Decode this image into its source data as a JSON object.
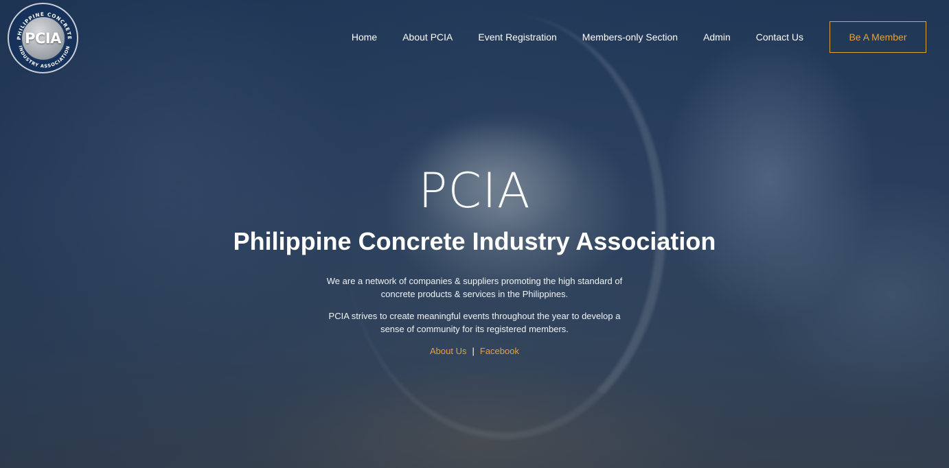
{
  "logo": {
    "abbr": "PCIA",
    "ring_top": "PHILIPPINE CONCRETE",
    "ring_bottom": "INDUSTRY ASSOCIATION"
  },
  "nav": {
    "items": [
      {
        "label": "Home"
      },
      {
        "label": "About PCIA"
      },
      {
        "label": "Event Registration"
      },
      {
        "label": "Members-only Section"
      },
      {
        "label": "Admin"
      },
      {
        "label": "Contact Us"
      }
    ],
    "cta_label": "Be A Member"
  },
  "hero": {
    "title": "PCIA",
    "subtitle": "Philippine Concrete Industry Association",
    "paragraph_1": "We are a network of companies & suppliers promoting the high standard of concrete products & services in the Philippines.",
    "paragraph_2": "PCIA strives to create meaningful events throughout the year to develop a sense of community for its registered members.",
    "link_about": "About Us",
    "separator": "|",
    "link_facebook": "Facebook"
  },
  "colors": {
    "accent": "#e5a23a",
    "background": "#2b3f5c",
    "text": "#ffffff"
  }
}
